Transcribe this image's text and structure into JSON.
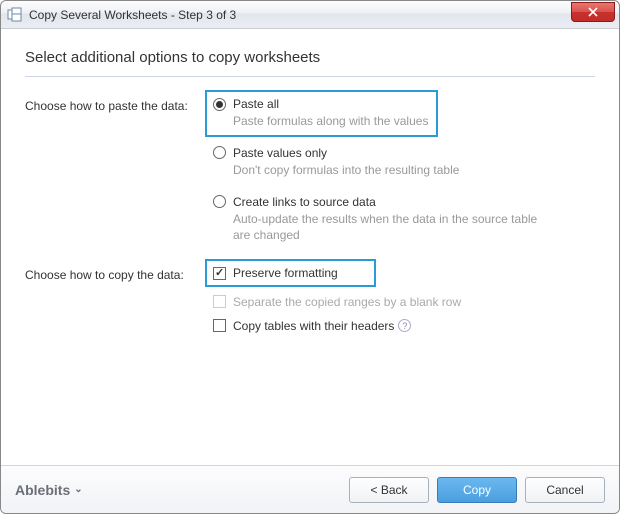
{
  "window": {
    "title": "Copy Several Worksheets - Step 3 of 3"
  },
  "heading": "Select additional options to copy worksheets",
  "paste": {
    "label": "Choose how to paste the data:",
    "options": [
      {
        "label": "Paste all",
        "desc": "Paste formulas along with the values",
        "checked": true,
        "highlighted": true
      },
      {
        "label": "Paste values only",
        "desc": "Don't copy formulas into the resulting table",
        "checked": false
      },
      {
        "label": "Create links to source data",
        "desc": "Auto-update the results when the data in the source table are changed",
        "checked": false
      }
    ]
  },
  "copy": {
    "label": "Choose how to copy the data:",
    "options": [
      {
        "label": "Preserve formatting",
        "checked": true,
        "highlighted": true,
        "disabled": false
      },
      {
        "label": "Separate the copied ranges by a blank row",
        "checked": false,
        "disabled": true
      },
      {
        "label": "Copy tables with their headers",
        "checked": false,
        "disabled": false,
        "help": true
      }
    ]
  },
  "footer": {
    "brand": "Ablebits",
    "back": "< Back",
    "copy": "Copy",
    "cancel": "Cancel"
  }
}
